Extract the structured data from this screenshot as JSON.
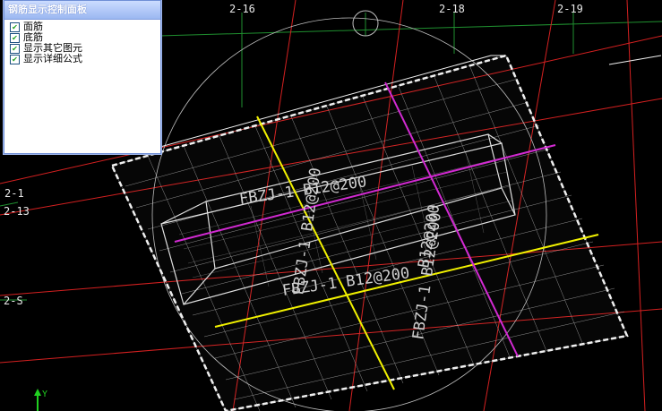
{
  "panel": {
    "title": "钢筋显示控制面板",
    "options": [
      {
        "label": "面筋",
        "checked": true
      },
      {
        "label": "底筋",
        "checked": true
      },
      {
        "label": "显示其它图元",
        "checked": true
      },
      {
        "label": "显示详细公式",
        "checked": true
      }
    ]
  },
  "axes": {
    "top": [
      "2-16",
      "2-18",
      "2-19"
    ],
    "left": [
      "2-1",
      "2-13",
      "2-S"
    ],
    "coord": "Y"
  },
  "rebar_labels": {
    "a": "FBZJ-1 B12@200",
    "b": "FBZJ-1 B12@200",
    "c": "B12@200",
    "d": "FBZJ-1 B12@200",
    "e": "FBZJ-1 B12@200"
  },
  "colors": {
    "background": "#000000",
    "grid_red": "#d42020",
    "grid_green": "#1f8f2f",
    "slab_white": "#f0f0f0",
    "rebar_yellow": "#f2f200",
    "rebar_magenta": "#d22ad2"
  }
}
